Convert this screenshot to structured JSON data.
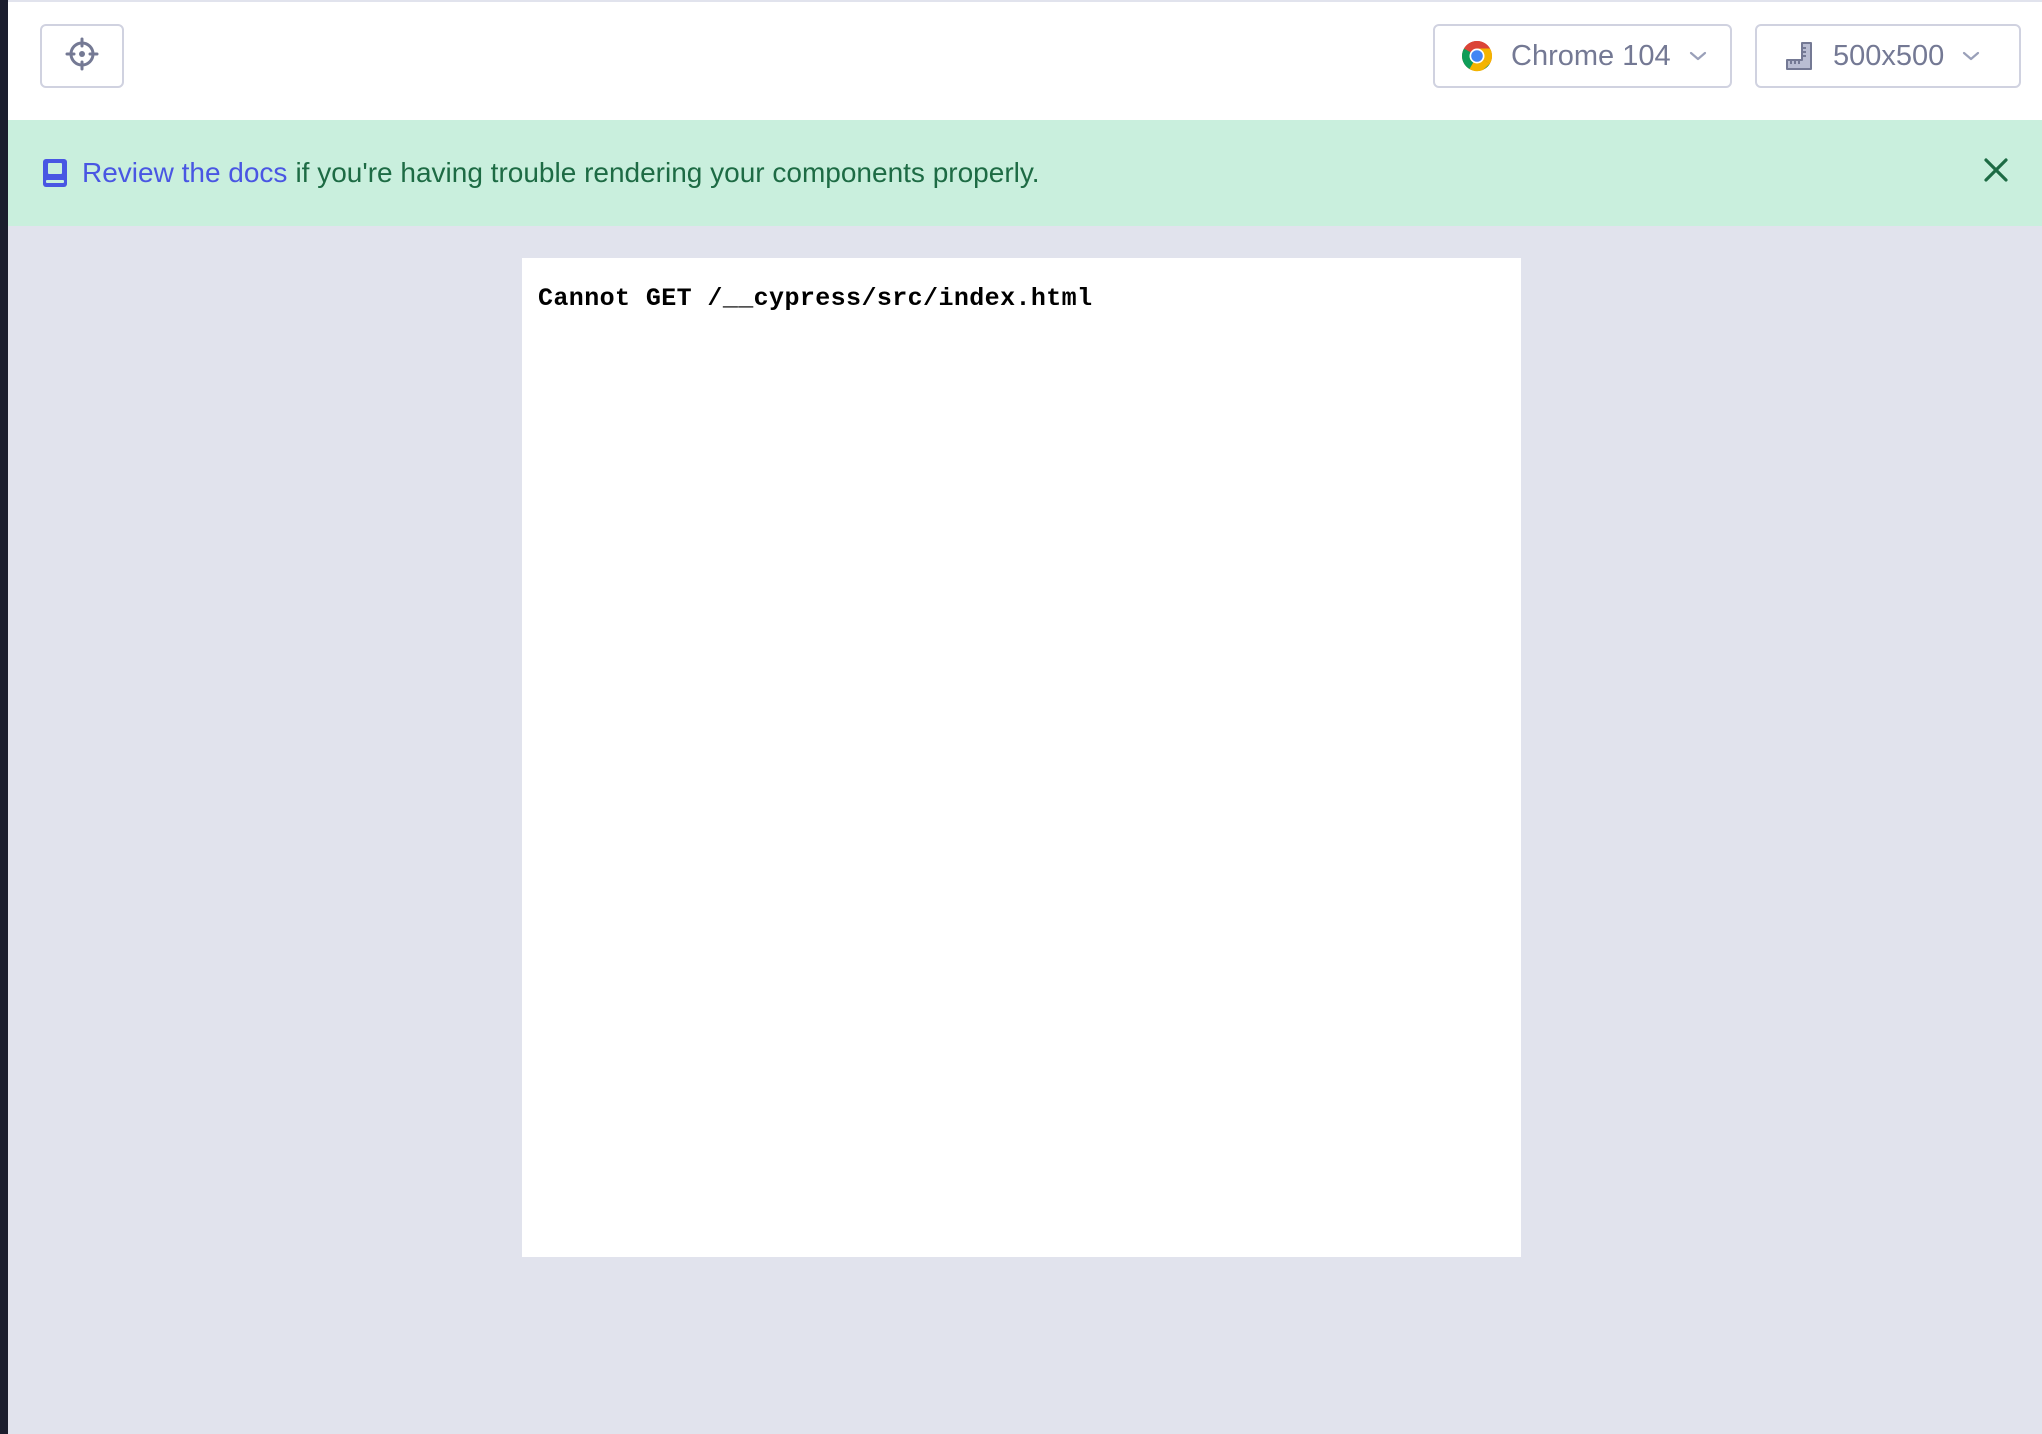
{
  "toolbar": {
    "selector_icon": "crosshair-icon",
    "browser": {
      "icon": "chrome-icon",
      "label": "Chrome 104"
    },
    "viewport": {
      "icon": "ruler-icon",
      "label": "500x500"
    }
  },
  "banner": {
    "icon": "book-icon",
    "link_text": "Review the docs",
    "text": "if you're having trouble rendering your components properly.",
    "background": "#c9efdd",
    "text_color": "#1d6b44",
    "link_color": "#4956e3"
  },
  "preview": {
    "message": "Cannot GET /__cypress/src/index.html"
  }
}
